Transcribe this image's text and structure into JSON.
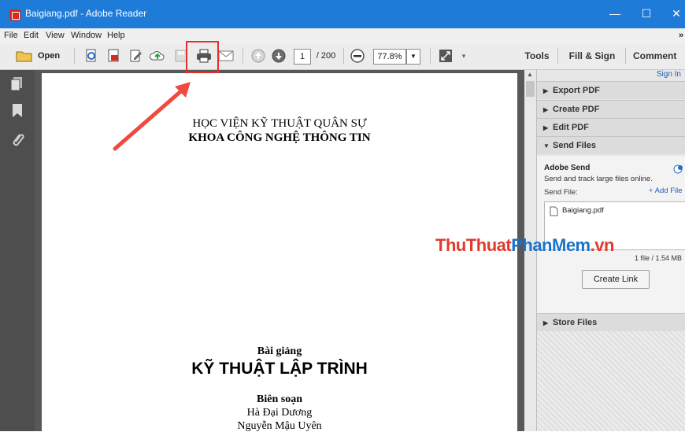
{
  "window": {
    "title": "Baigiang.pdf - Adobe Reader",
    "controls": {
      "minimize": "—",
      "maximize": "☐",
      "close": "✕"
    }
  },
  "menu": [
    "File",
    "Edit",
    "View",
    "Window",
    "Help"
  ],
  "menu_overflow": "»",
  "toolbar": {
    "open_label": "Open",
    "current_page": "1",
    "total_pages": "/ 200",
    "zoom": "77.8%",
    "tools_label": "Tools",
    "fill_sign_label": "Fill & Sign",
    "comment_label": "Comment"
  },
  "document": {
    "institution": "HỌC VIỆN KỸ THUẬT QUÂN SỰ",
    "faculty": "KHOA CÔNG NGHỆ THÔNG TIN",
    "doc_type": "Bài giảng",
    "doc_title": "KỸ THUẬT LẬP TRÌNH",
    "authors_heading": "Biên soạn",
    "authors": [
      "Hà Đại Dương",
      "Nguyễn Mậu Uyên"
    ]
  },
  "right_panel": {
    "sign_in": "Sign In",
    "sections": [
      "Export PDF",
      "Create PDF",
      "Edit PDF",
      "Send Files"
    ],
    "send": {
      "heading": "Adobe Send",
      "description": "Send and track large files online.",
      "send_file_label": "Send File:",
      "add_file": "+ Add File",
      "file_name": "Baigiang.pdf",
      "file_summary": "1 file / 1.54 MB",
      "create_link": "Create Link"
    },
    "store_files": "Store Files"
  },
  "watermark": {
    "part1": "ThuThuat",
    "part2": "PhanMem",
    "part3": ".vn"
  },
  "colors": {
    "titlebar": "#1f7bd8",
    "highlight": "#e0322d",
    "link": "#1c5fb4"
  }
}
